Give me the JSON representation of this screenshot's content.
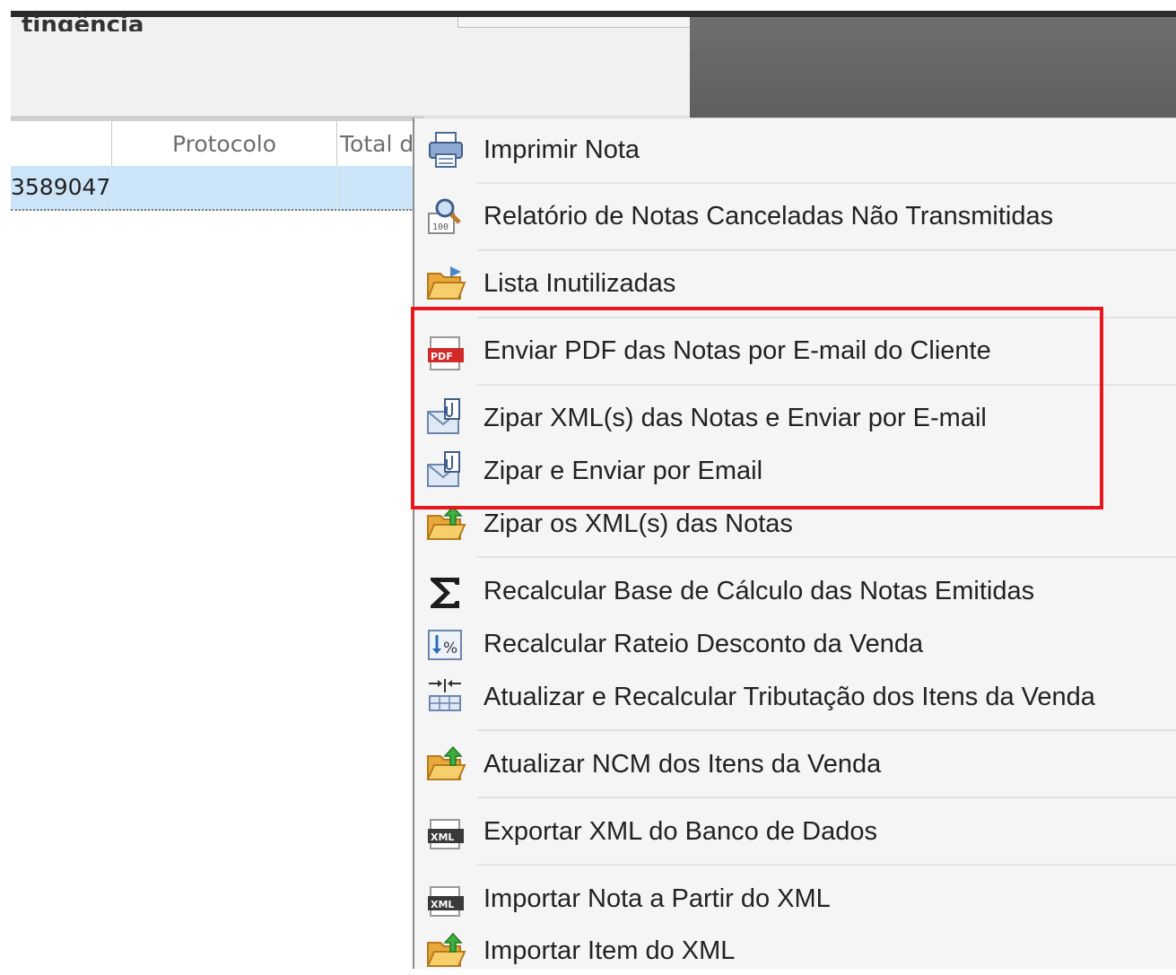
{
  "form": {
    "title": "tingência"
  },
  "grid": {
    "columns": [
      "",
      "Protocolo",
      "Total d"
    ],
    "row": [
      "3589047",
      "",
      ""
    ]
  },
  "menu": {
    "items": [
      {
        "label": "Imprimir Nota",
        "icon": "printer-icon"
      },
      {
        "label": "Relatório de Notas Canceladas Não Transmitidas",
        "icon": "report-search-icon"
      },
      {
        "label": "Lista Inutilizadas",
        "icon": "folder-open-icon"
      },
      {
        "label": "Enviar PDF das Notas por E-mail do Cliente",
        "icon": "pdf-icon"
      },
      {
        "label": "Zipar XML(s) das Notas e Enviar por E-mail",
        "icon": "email-attachment-icon"
      },
      {
        "label": "Zipar e Enviar por Email",
        "icon": "email-attachment-icon"
      },
      {
        "label": "Zipar os XML(s) das Notas",
        "icon": "folder-upload-icon"
      },
      {
        "label": "Recalcular Base de Cálculo das Notas Emitidas",
        "icon": "sigma-icon"
      },
      {
        "label": "Recalcular Rateio Desconto da Venda",
        "icon": "percent-icon"
      },
      {
        "label": "Atualizar e Recalcular Tributação dos Itens da Venda",
        "icon": "table-columns-icon"
      },
      {
        "label": "Atualizar NCM dos Itens da Venda",
        "icon": "folder-upload-icon"
      },
      {
        "label": "Exportar XML do Banco de Dados",
        "icon": "xml-file-icon"
      },
      {
        "label": "Importar Nota a Partir do XML",
        "icon": "xml-file-icon"
      },
      {
        "label": "Importar Item do XML",
        "icon": "folder-upload-icon"
      }
    ]
  },
  "colors": {
    "highlight": "#e8161d",
    "selected_row": "#cce4f7",
    "menu_bg": "#f5f5f5"
  }
}
